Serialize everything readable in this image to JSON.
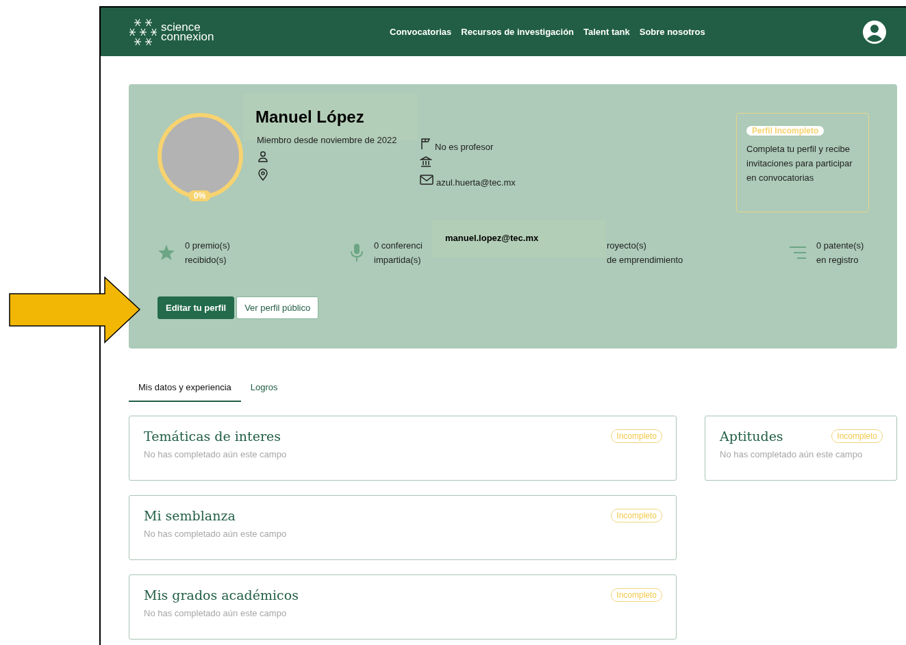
{
  "nav": {
    "logo_top": "science",
    "logo_bottom": "connexion",
    "links": [
      "Convocatorias",
      "Recursos de investigación",
      "Talent tank",
      "Sobre nosotros"
    ]
  },
  "profile": {
    "name": "Manuel López",
    "member_since": "Miembro desde noviembre de 2022",
    "progress_label": "0%",
    "left_details": [
      {
        "kind": "person"
      },
      {
        "kind": "location"
      }
    ],
    "details": [
      {
        "kind": "teacher",
        "text": "No es profesor"
      },
      {
        "kind": "institution"
      },
      {
        "kind": "email",
        "text": "azul.huerta@tec.mx"
      }
    ]
  },
  "notice": {
    "badge": "Perfil Incompleto",
    "text": "Completa tu perfil y recibe invitaciones para participar en convocatorias"
  },
  "stats": [
    {
      "kind": "awards",
      "line1": "0 premio(s)",
      "line2": "recibido(s)"
    },
    {
      "kind": "talks",
      "line1": "0 conferenci",
      "line2": "impartida(s)"
    },
    {
      "kind": "projects",
      "line1": "royecto(s)",
      "line2": "de emprendimiento"
    },
    {
      "kind": "patents",
      "line1": "0 patente(s)",
      "line2": "en registro"
    }
  ],
  "tooltip": "manuel.lopez@tec.mx",
  "buttons": [
    {
      "kind": "primary",
      "label": "Editar tu perfil"
    },
    {
      "kind": "secondary",
      "label": "Ver perfil público"
    }
  ],
  "tabs": [
    {
      "label": "Mis datos y experiencia",
      "selected": true
    },
    {
      "label": "Logros",
      "selected": false
    }
  ],
  "main_sections": [
    {
      "title": "Temáticas de interes",
      "status": "Incompleto",
      "hint": "No has completado aún este campo"
    },
    {
      "title": "Mi semblanza",
      "status": "Incompleto",
      "hint": "No has completado aún este campo"
    },
    {
      "title": "Mis grados académicos",
      "status": "Incompleto",
      "hint": "No has completado aún este campo"
    }
  ],
  "side_sections": [
    {
      "title": "Aptitudes",
      "status": "Incompleto",
      "hint": "No has completado aún este campo"
    }
  ]
}
